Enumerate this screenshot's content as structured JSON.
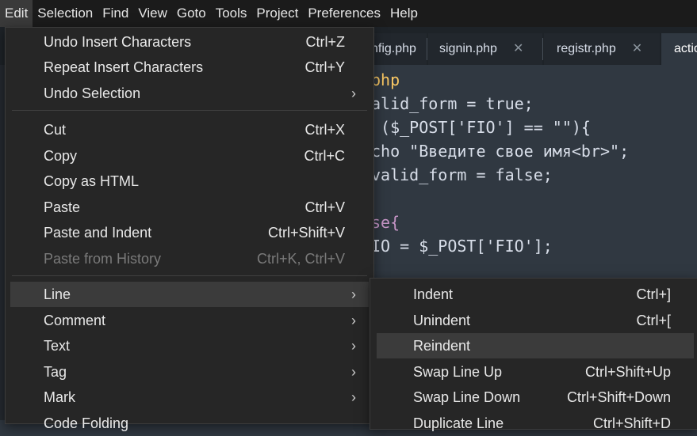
{
  "menubar": {
    "items": [
      "Edit",
      "Selection",
      "Find",
      "View",
      "Goto",
      "Tools",
      "Project",
      "Preferences",
      "Help"
    ]
  },
  "tabs": [
    {
      "label": "nfig.php"
    },
    {
      "label": "signin.php"
    },
    {
      "label": "registr.php"
    },
    {
      "label": "actio"
    }
  ],
  "tab_close_glyph": "✕",
  "code_lines": [
    "php",
    "alid_form = true;",
    " ($_POST['FIO'] == \"\"){",
    "cho \"Введите свое имя<br>\";",
    "valid_form = false;",
    "",
    "se{",
    "IO = $_POST['FIO'];"
  ],
  "edit_menu": {
    "items": [
      {
        "label": "Undo Insert Characters",
        "shortcut": "Ctrl+Z"
      },
      {
        "label": "Repeat Insert Characters",
        "shortcut": "Ctrl+Y"
      },
      {
        "label": "Undo Selection",
        "shortcut": "",
        "submenu": true
      },
      {
        "label": "Cut",
        "shortcut": "Ctrl+X"
      },
      {
        "label": "Copy",
        "shortcut": "Ctrl+C"
      },
      {
        "label": "Copy as HTML",
        "shortcut": ""
      },
      {
        "label": "Paste",
        "shortcut": "Ctrl+V"
      },
      {
        "label": "Paste and Indent",
        "shortcut": "Ctrl+Shift+V"
      },
      {
        "label": "Paste from History",
        "shortcut": "Ctrl+K, Ctrl+V",
        "disabled": true
      },
      {
        "label": "Line",
        "shortcut": "",
        "submenu": true,
        "highlighted": true
      },
      {
        "label": "Comment",
        "shortcut": "",
        "submenu": true
      },
      {
        "label": "Text",
        "shortcut": "",
        "submenu": true
      },
      {
        "label": "Tag",
        "shortcut": "",
        "submenu": true
      },
      {
        "label": "Mark",
        "shortcut": "",
        "submenu": true
      },
      {
        "label": "Code Folding",
        "shortcut": "",
        "submenu": true
      }
    ]
  },
  "line_submenu": {
    "items": [
      {
        "label": "Indent",
        "shortcut": "Ctrl+]"
      },
      {
        "label": "Unindent",
        "shortcut": "Ctrl+["
      },
      {
        "label": "Reindent",
        "shortcut": "",
        "highlighted": true
      },
      {
        "label": "Swap Line Up",
        "shortcut": "Ctrl+Shift+Up"
      },
      {
        "label": "Swap Line Down",
        "shortcut": "Ctrl+Shift+Down"
      },
      {
        "label": "Duplicate Line",
        "shortcut": "Ctrl+Shift+D"
      }
    ]
  },
  "submenu_arrow": "›"
}
